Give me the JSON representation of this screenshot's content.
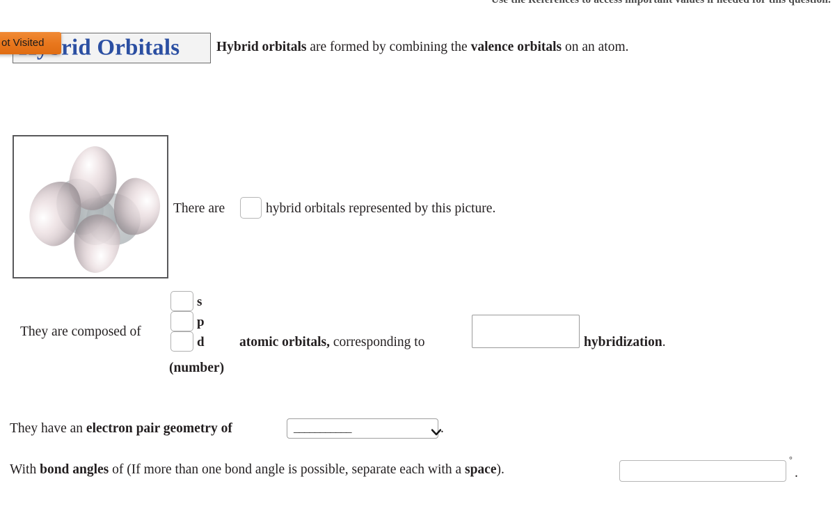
{
  "header": {
    "instruction": "Use the References to access important values if needed for this question.",
    "title": "Hybrid Orbitals",
    "tooltip": "ot Visited",
    "intro_1": "Hybrid orbitals",
    "intro_2": " are formed by combining the ",
    "intro_3": "valence orbitals",
    "intro_4": " on an atom."
  },
  "figure": {
    "alt": "tetrahedral sp3 hybrid orbital diagram"
  },
  "count_line": {
    "prefix": "There are",
    "suffix": "hybrid orbitals represented by this picture.",
    "input_value": "",
    "input_placeholder": ""
  },
  "composed_line": {
    "prefix": "They are composed of",
    "labels": [
      "s",
      "p",
      "d"
    ],
    "values": [
      "",
      "",
      ""
    ],
    "number_caption": "(number)",
    "mid_bold": "atomic orbitals,",
    "mid_text": " corresponding to",
    "hybridization_value": "",
    "suffix_bold": "hybridization",
    "suffix_period": "."
  },
  "geometry_line": {
    "prefix_1": "They have an ",
    "prefix_bold": "electron pair geometry of",
    "select_value": "___________",
    "select_options": [
      "___________"
    ],
    "period": "."
  },
  "angle_line": {
    "prefix": "With ",
    "bold_1": "bond angles",
    "mid": " of (If more than one bond angle is possible, separate each with a ",
    "bold_2": "space",
    "close": ").",
    "input_value": "",
    "degree": "°",
    "period": "."
  },
  "colors": {
    "title_blue": "#2b4fa2",
    "tooltip_orange": "#e8761c",
    "text": "#231f20",
    "border_gray": "#b6b6b6"
  }
}
